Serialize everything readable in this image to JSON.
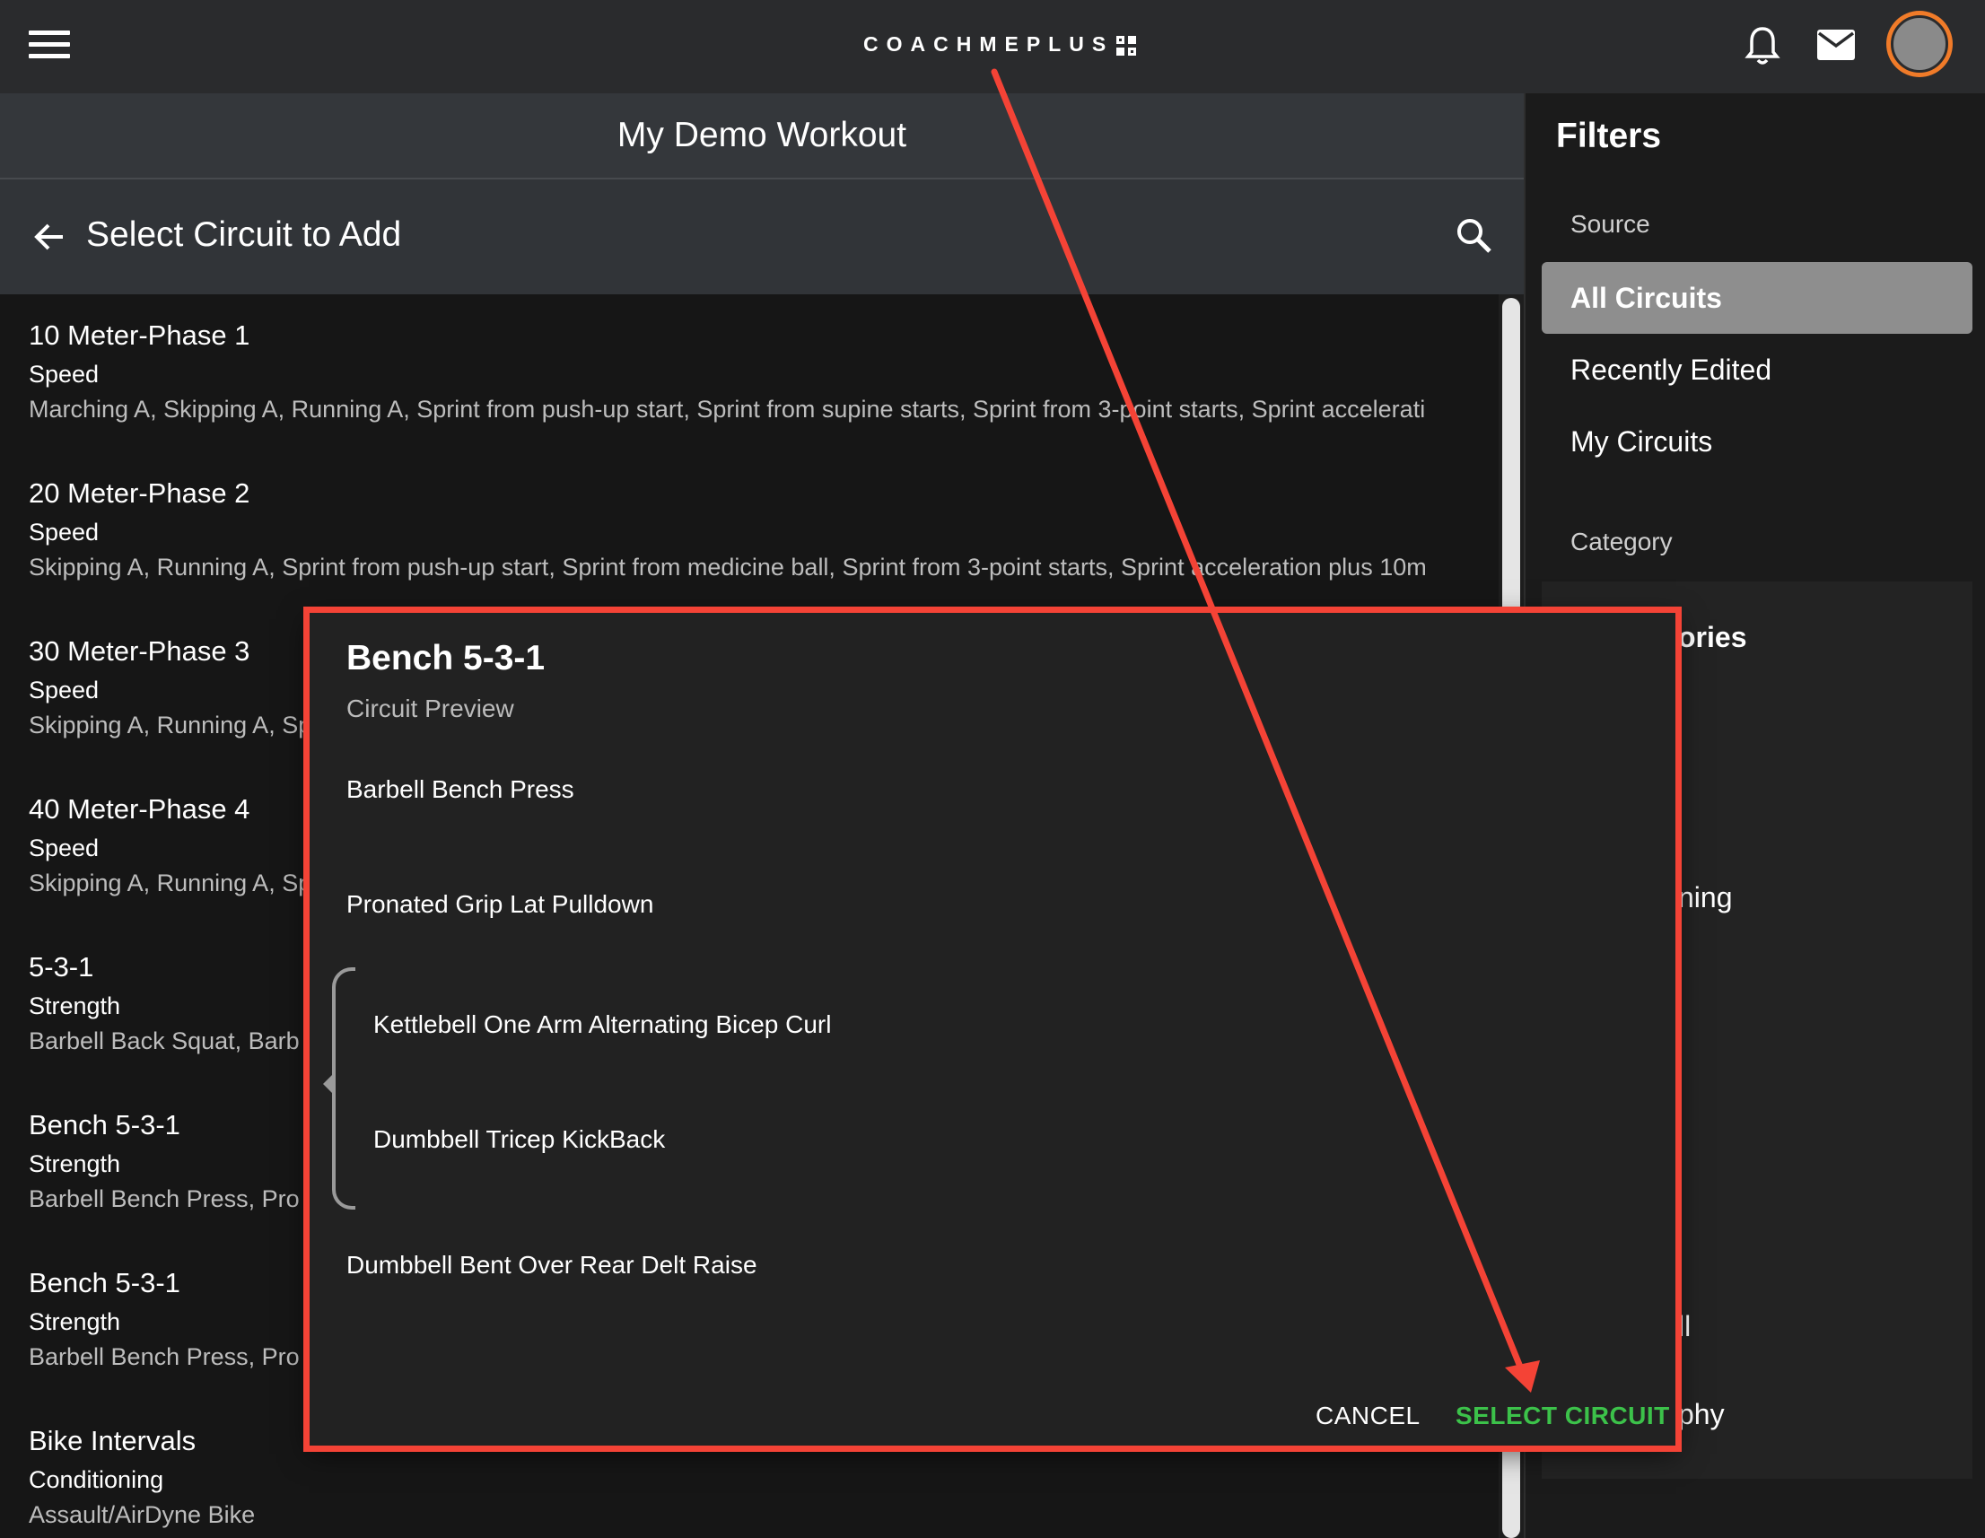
{
  "topbar": {
    "logo_text": "COACHMEPLUS",
    "icons": [
      "menu-icon",
      "bell-icon",
      "mail-icon",
      "avatar"
    ],
    "accent": "#f07b29"
  },
  "workout": {
    "title": "My Demo Workout"
  },
  "select_bar": {
    "title": "Select Circuit to Add"
  },
  "circuits": [
    {
      "name": "10 Meter-Phase 1",
      "category": "Speed",
      "exercises": "Marching A, Skipping A, Running A, Sprint from push-up start, Sprint from supine starts, Sprint from 3-point starts, Sprint accelerati"
    },
    {
      "name": "20 Meter-Phase 2",
      "category": "Speed",
      "exercises": "Skipping A, Running A, Sprint from push-up start, Sprint from medicine ball, Sprint from 3-point starts, Sprint acceleration plus 10m"
    },
    {
      "name": "30 Meter-Phase 3",
      "category": "Speed",
      "exercises": "Skipping A, Running A, Sp"
    },
    {
      "name": "40 Meter-Phase 4",
      "category": "Speed",
      "exercises": "Skipping A, Running A, Sp"
    },
    {
      "name": "5-3-1",
      "category": "Strength",
      "exercises": "Barbell Back Squat, Barb"
    },
    {
      "name": "Bench 5-3-1",
      "category": "Strength",
      "exercises": "Barbell Bench Press, Pro"
    },
    {
      "name": "Bench 5-3-1",
      "category": "Strength",
      "exercises": "Barbell Bench Press, Pro"
    },
    {
      "name": "Bike Intervals",
      "category": "Conditioning",
      "exercises": "Assault/AirDyne Bike"
    }
  ],
  "filters": {
    "title": "Filters",
    "source_label": "Source",
    "source_items": [
      {
        "label": "All Circuits",
        "active": true
      },
      {
        "label": "Recently Edited",
        "active": false
      },
      {
        "label": "My Circuits",
        "active": false
      }
    ],
    "category_label": "Category",
    "category_peek": [
      "ories",
      "ning",
      "ll",
      "phy"
    ]
  },
  "dialog": {
    "title": "Bench 5-3-1",
    "subtitle": "Circuit Preview",
    "exercises": [
      "Barbell Bench Press",
      "Pronated Grip Lat Pulldown",
      "Kettlebell One Arm Alternating Bicep Curl",
      "Dumbbell Tricep KickBack",
      "Dumbbell Bent Over Rear Delt Raise"
    ],
    "cancel_label": "CANCEL",
    "select_label": "SELECT CIRCUIT",
    "select_color": "#3cc24a"
  },
  "annotation": {
    "color": "#f44336"
  }
}
